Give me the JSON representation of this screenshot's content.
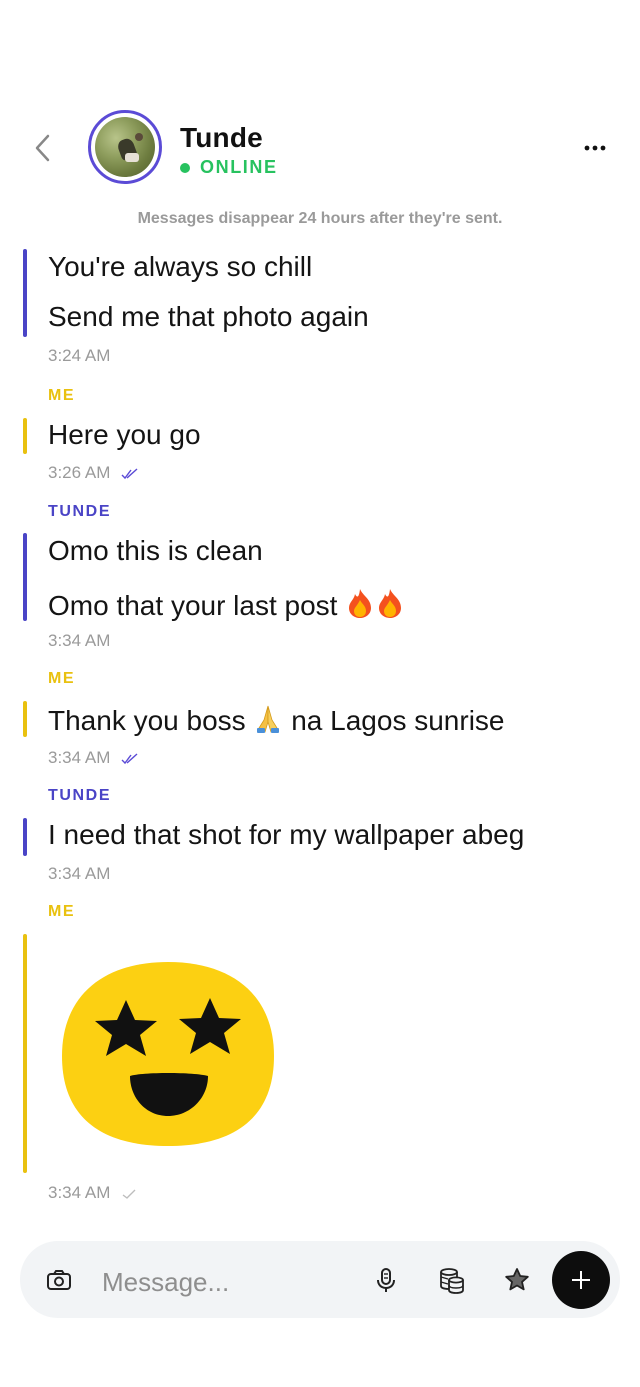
{
  "header": {
    "contact_name": "Tunde",
    "status": "ONLINE",
    "colors": {
      "accent": "#5b4bd6",
      "online": "#27c25f"
    },
    "icons": {
      "back": "chevron-left-icon",
      "more": "more-horizontal-icon"
    }
  },
  "notice": "Messages disappear 24 hours after they're sent.",
  "messages": [
    {
      "sender": "",
      "lines": [
        "You're always so chill",
        "Send me that photo again"
      ],
      "time": "3:24 AM"
    },
    {
      "sender": "ME",
      "lines": [
        "Here you go"
      ],
      "time": "3:26 AM",
      "receipt": "read"
    },
    {
      "sender": "TUNDE",
      "lines": [
        "Omo this is clean",
        "Omo that your last post"
      ],
      "emoji": "fire fire",
      "time": "3:34 AM"
    },
    {
      "sender": "ME",
      "lines": [
        "Thank you boss",
        "na Lagos sunrise"
      ],
      "emoji": "folded-hands",
      "time": "3:34 AM",
      "receipt": "read"
    },
    {
      "sender": "TUNDE",
      "lines": [
        "I need that shot for my wallpaper abeg"
      ],
      "time": "3:34 AM"
    },
    {
      "sender": "ME",
      "sticker": "star-struck-emoji",
      "time": "3:34 AM",
      "receipt": "sent"
    }
  ],
  "colors": {
    "them": "#4a44c6",
    "me": "#e9c10f"
  },
  "composer": {
    "placeholder": "Message...",
    "icons": [
      "camera-icon",
      "microphone-icon",
      "coins-icon",
      "star-icon",
      "plus-icon"
    ]
  }
}
